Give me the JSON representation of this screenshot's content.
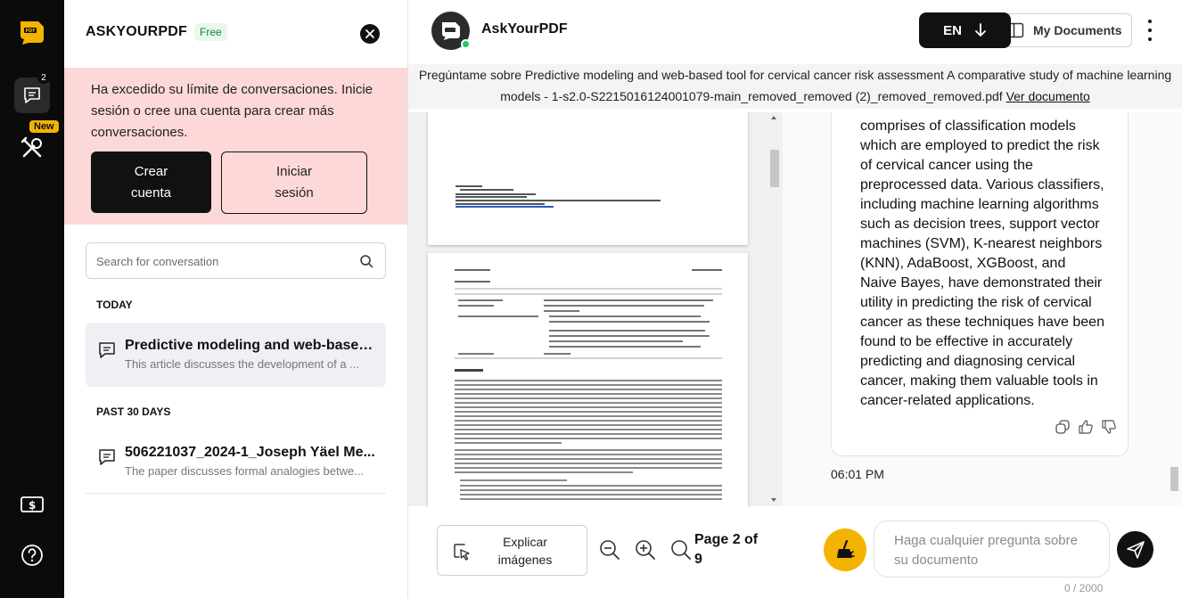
{
  "rail": {
    "chat_badge_count": "2",
    "new_badge": "New"
  },
  "sidebar": {
    "brand": "ASKYOURPDF",
    "plan": "Free",
    "alert": {
      "message": "Ha excedido su límite de conversaciones. Inicie sesión o cree una cuenta para crear más conversaciones.",
      "create_account": "Crear cuenta",
      "login": "Iniciar sesión"
    },
    "search": {
      "placeholder": "Search for conversation"
    },
    "groups": [
      {
        "label": "TODAY",
        "conversations": [
          {
            "title": "Predictive modeling and web-based t...",
            "subtitle": "This article discusses the development of a ..."
          }
        ]
      },
      {
        "label": "PAST 30 DAYS",
        "conversations": [
          {
            "title": "506221037_2024-1_Joseph Yäel Me...",
            "subtitle": "The paper discusses formal analogies betwe..."
          }
        ]
      }
    ]
  },
  "header": {
    "app_name": "AskYourPDF",
    "language": "EN",
    "my_documents": "My Documents"
  },
  "doc_banner": {
    "text": "Pregúntame sobre Predictive modeling and web-based tool for cervical cancer risk assessment A comparative study of machine learning models - 1-s2.0-S2215016124001079-main_removed_removed (2)_removed_removed.pdf",
    "link": "Ver documento"
  },
  "chat": {
    "message": "comprises of classification models which are employed to predict the risk of cervical cancer using the preprocessed data. Various classifiers, including machine learning algorithms such as decision trees, support vector machines (SVM), K-nearest neighbors (KNN), AdaBoost, XGBoost, and Naive Bayes, have demonstrated their utility in predicting the risk of cervical cancer as these techniques have been found to be effective in accurately predicting and diagnosing cervical cancer, making them valuable tools in cancer-related applications.",
    "timestamp": "06:01 PM"
  },
  "bottom": {
    "explain_images": "Explicar imágenes",
    "page_indicator": "Page 2 of 9",
    "input_placeholder": "Haga cualquier pregunta sobre su documento",
    "char_counter": "0 / 2000"
  },
  "colors": {
    "accent_yellow": "#f5b301",
    "alert_bg": "#fdd8d8",
    "dark": "#111111",
    "online_green": "#22c55e"
  }
}
